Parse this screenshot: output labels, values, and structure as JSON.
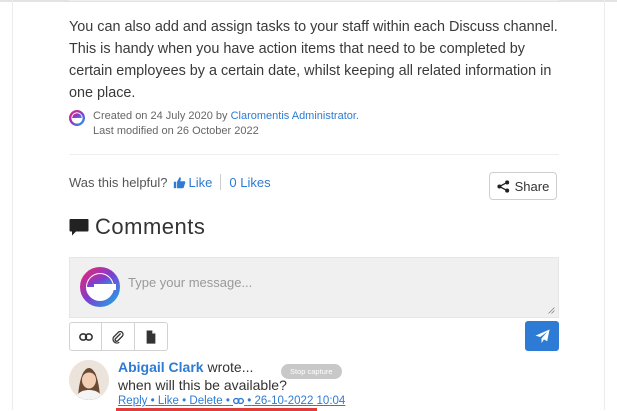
{
  "article": {
    "intro": "You can also add and assign tasks to your staff within each Discuss channel. This is handy when you have action items that need to be completed by certain employees by a certain date, whilst keeping all related information in one place."
  },
  "meta": {
    "created_prefix": "Created on 24 July 2020 by ",
    "author": "Claromentis Administrator",
    "created_suffix": ".",
    "modified": "Last modified on 26 October 2022"
  },
  "feedback": {
    "question": "Was this helpful?",
    "like_label": "Like",
    "likes_count": "0 Likes"
  },
  "share": {
    "label": "Share"
  },
  "comments": {
    "heading": "Comments",
    "placeholder": "Type your message...",
    "toolbar_icons": [
      "link-icon",
      "paperclip-icon",
      "document-icon"
    ],
    "send_icon": "paper-plane-icon",
    "items": [
      {
        "author": "Abigail Clark",
        "wrote": "wrote...",
        "text": "when will this be available?",
        "actions": {
          "reply": "Reply",
          "like": "Like",
          "delete": "Delete",
          "dot": "•",
          "timestamp": "26-10-2022 10:04"
        }
      }
    ]
  },
  "overlay": {
    "stop_capture": "Stop capture"
  },
  "colors": {
    "link": "#2d7bd4",
    "send_button": "#2d7bd4",
    "highlight": "#e23b3b"
  }
}
